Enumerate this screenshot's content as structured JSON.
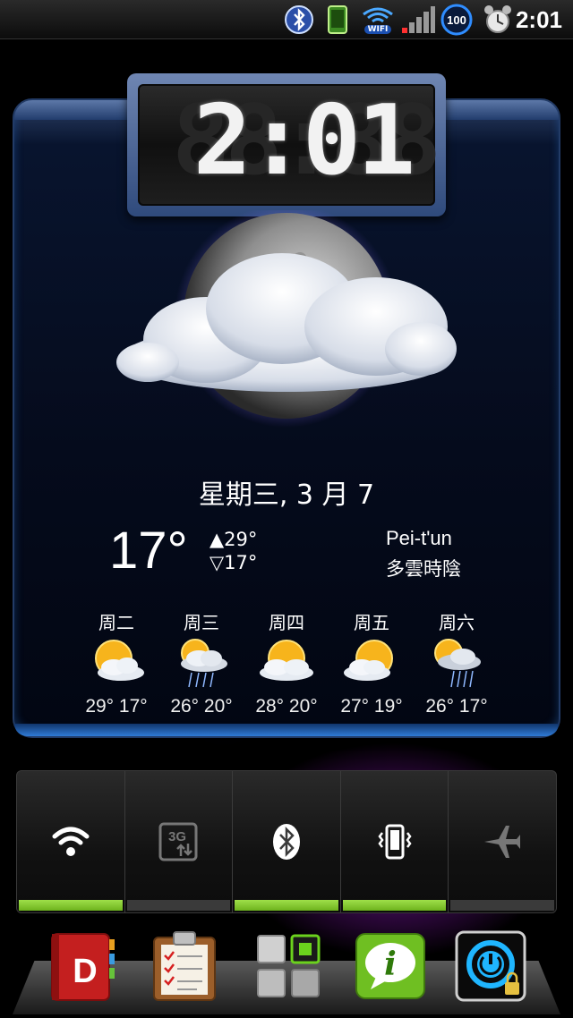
{
  "status_bar": {
    "time": "2:01",
    "battery_level": "100",
    "wifi_label": "WIFI",
    "icons": [
      "bluetooth-icon",
      "screen-icon",
      "wifi-icon",
      "signal-icon",
      "battery-icon",
      "alarm-icon"
    ]
  },
  "weather": {
    "clock_time": "2:01",
    "date": "星期三, 3 月 7",
    "current_temp": "17°",
    "high_temp": "▲29°",
    "low_temp": "▽17°",
    "city": "Pei-t'un",
    "condition": "多雲時陰",
    "forecast": [
      {
        "day": "周二",
        "temps": "29° 17°",
        "icon": "partly-sunny-icon"
      },
      {
        "day": "周三",
        "temps": "26° 20°",
        "icon": "sun-rain-icon"
      },
      {
        "day": "周四",
        "temps": "28° 20°",
        "icon": "partly-sunny-icon"
      },
      {
        "day": "周五",
        "temps": "27° 19°",
        "icon": "partly-sunny-icon"
      },
      {
        "day": "周六",
        "temps": "26° 17°",
        "icon": "sun-rain-icon"
      }
    ]
  },
  "toggles": [
    {
      "name": "wifi-toggle",
      "icon": "wifi-icon",
      "on": true
    },
    {
      "name": "3g-data-toggle",
      "icon": "3g-data-icon",
      "label": "3G",
      "on": false
    },
    {
      "name": "bluetooth-toggle",
      "icon": "bluetooth-icon",
      "on": true
    },
    {
      "name": "vibrate-toggle",
      "icon": "vibrate-icon",
      "on": true
    },
    {
      "name": "airplane-toggle",
      "icon": "airplane-icon",
      "on": false
    }
  ],
  "dock": {
    "apps": [
      "dictionary-app-icon",
      "clipboard-notes-app-icon",
      "app-drawer-icon",
      "info-messages-app-icon",
      "power-lock-app-icon"
    ],
    "dictionary_letter": "D",
    "info_letter": "i"
  },
  "colors": {
    "toggle_on": "#8bd136",
    "panel_blue": "#2f7bd6",
    "glow_purple": "#c83cdc"
  }
}
